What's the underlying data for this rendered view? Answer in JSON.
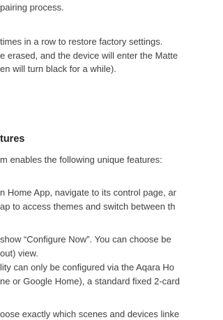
{
  "document": {
    "lines_top": [
      "pairing process.",
      "times in a row to restore factory settings.",
      "e erased, and the device will enter the Matte",
      "en will turn black for a while)."
    ],
    "heading": "tures",
    "lines_bottom": [
      "m enables the following unique features:",
      "n Home App, navigate to its control page, ar",
      "ap to access themes and switch between th",
      "show “Configure Now”. You can choose be",
      "out) view.",
      "lity can only be configured via the Aqara Ho",
      "ne or Google Home), a standard fixed 2-card",
      "oose exactly which scenes and devices linke"
    ]
  }
}
